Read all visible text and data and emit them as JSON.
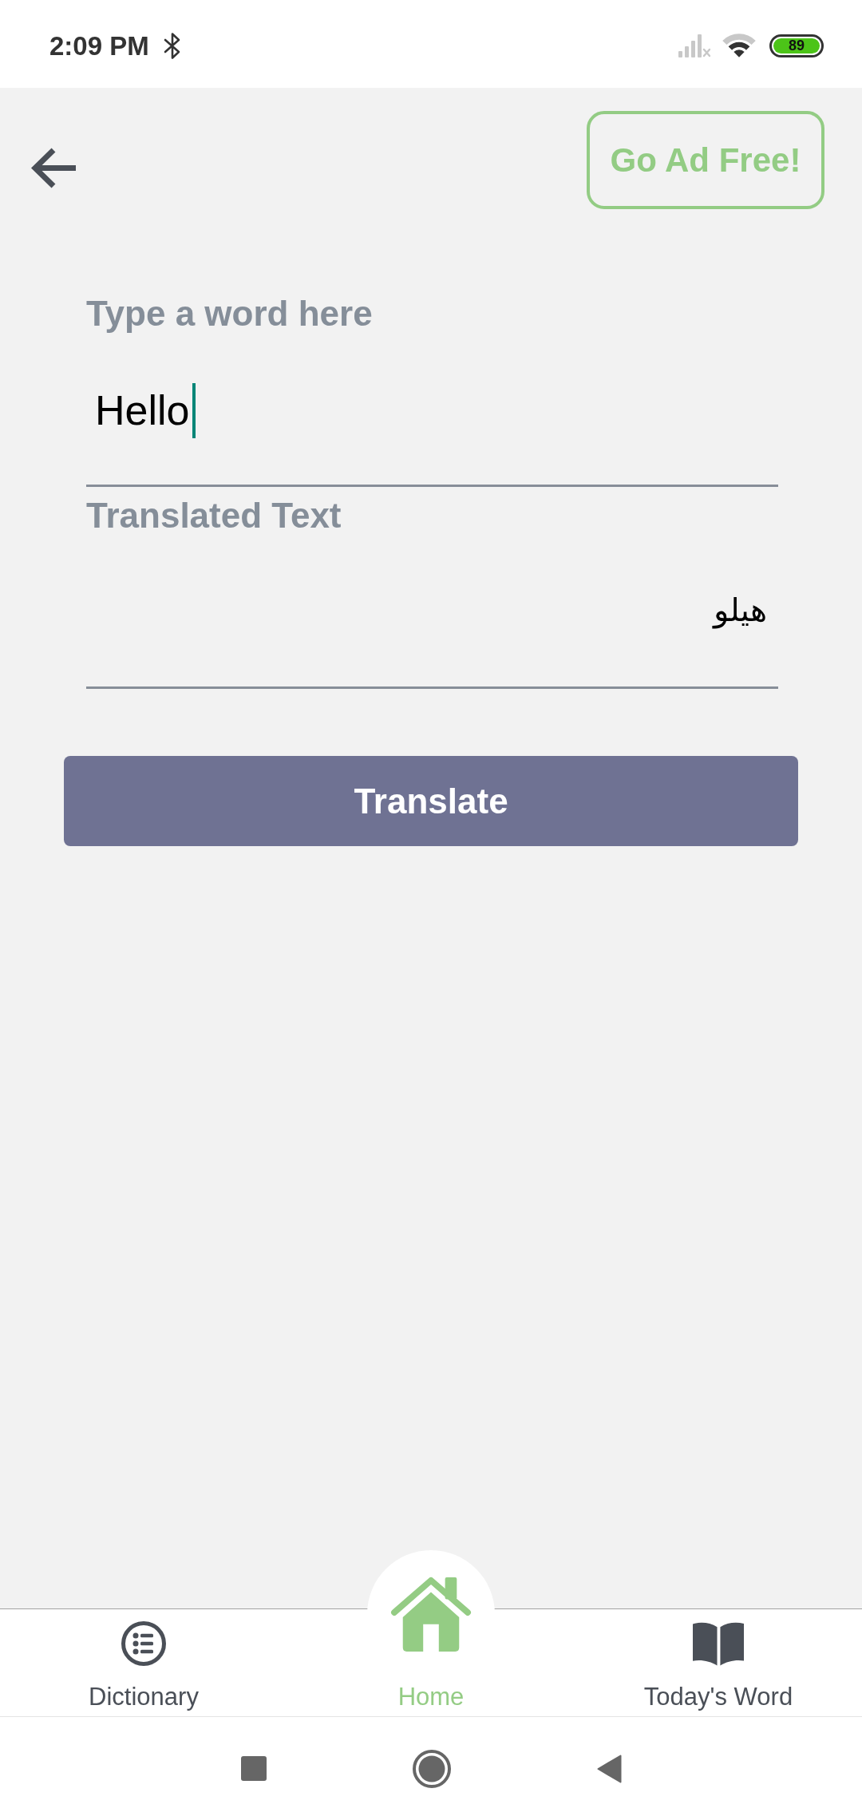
{
  "status_bar": {
    "time": "2:09 PM",
    "battery": "89"
  },
  "header": {
    "ad_free_button": "Go Ad Free!"
  },
  "translator": {
    "input": {
      "label": "Type a word here",
      "value": "Hello"
    },
    "output": {
      "label": "Translated Text",
      "value": "هيلو"
    },
    "translate_button": "Translate"
  },
  "bottom_nav": [
    {
      "label": "Dictionary",
      "selected": false
    },
    {
      "label": "Home",
      "selected": true
    },
    {
      "label": "Today's Word",
      "selected": false
    }
  ]
}
